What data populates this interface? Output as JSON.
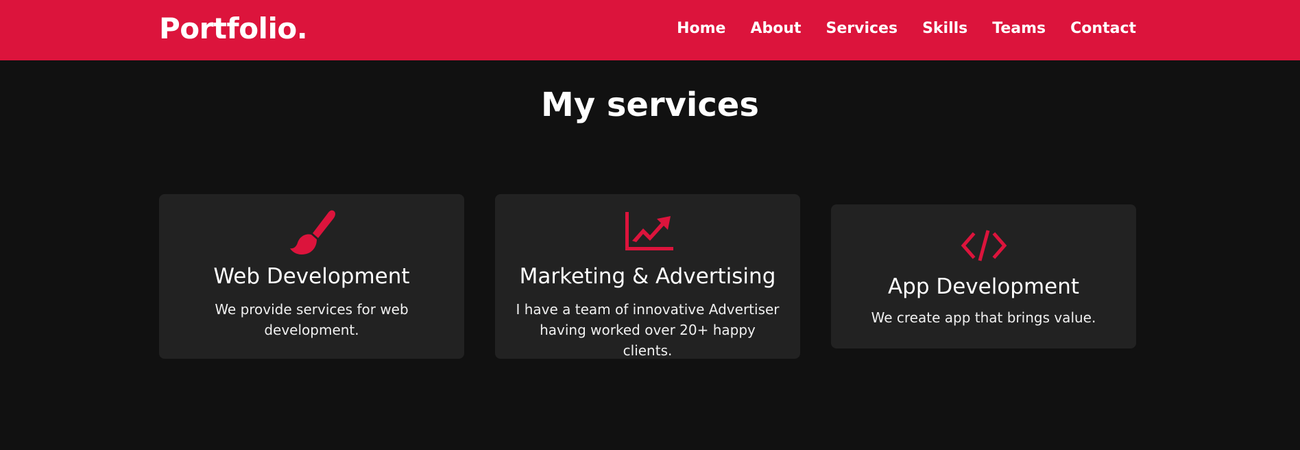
{
  "colors": {
    "accent": "#dc143c",
    "background": "#111111",
    "card_background": "#222222",
    "text": "#ffffff"
  },
  "nav": {
    "logo": "Portfolio.",
    "links": [
      "Home",
      "About",
      "Services",
      "Skills",
      "Teams",
      "Contact"
    ]
  },
  "services": {
    "title": "My services",
    "cards": [
      {
        "icon": "paint-brush-icon",
        "title": "Web Development",
        "description": "We provide services for web development."
      },
      {
        "icon": "chart-line-icon",
        "title": "Marketing & Advertising",
        "description": "I have a team of innovative Advertiser having worked over 20+ happy clients."
      },
      {
        "icon": "code-icon",
        "title": "App Development",
        "description": "We create app that brings value."
      }
    ]
  }
}
